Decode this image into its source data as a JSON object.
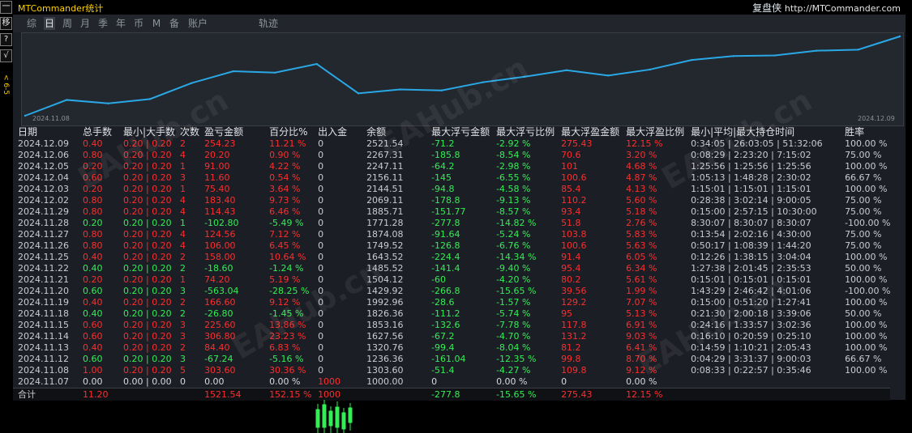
{
  "titlebar": {
    "app_name": "MTCommander统计",
    "brand": "复盘侠",
    "url": "http://MTCommander.com"
  },
  "left_tools": [
    "一",
    "移",
    "?",
    "√"
  ],
  "left_vertical_text": "< 6-5",
  "tabs": [
    "综",
    "日",
    "周",
    "月",
    "季",
    "年",
    "币",
    "M",
    "备",
    "账户",
    "轨迹"
  ],
  "active_tab": "日",
  "chart": {
    "start_date": "2024.11.08",
    "end_date": "2024.12.09",
    "line_color": "#2aa8e6"
  },
  "chart_data": {
    "type": "line",
    "x": [
      "2024.11.07",
      "2024.11.08",
      "2024.11.12",
      "2024.11.13",
      "2024.11.14",
      "2024.11.15",
      "2024.11.18",
      "2024.11.19",
      "2024.11.20",
      "2024.11.21",
      "2024.11.22",
      "2024.11.25",
      "2024.11.26",
      "2024.11.27",
      "2024.11.28",
      "2024.11.29",
      "2024.12.02",
      "2024.12.03",
      "2024.12.04",
      "2024.12.05",
      "2024.12.06",
      "2024.12.09"
    ],
    "series": [
      {
        "values": [
          1000,
          1303.6,
          1236.36,
          1320.76,
          1627.56,
          1853.16,
          1826.36,
          1992.96,
          1429.92,
          1504.12,
          1485.52,
          1643.52,
          1749.52,
          1874.08,
          1771.28,
          1885.71,
          2069.11,
          2144.51,
          2156.11,
          2247.11,
          2267.31,
          2521.54
        ]
      }
    ]
  },
  "table": {
    "headers": [
      "日期",
      "总手数",
      "最小|大手数",
      "次数",
      "盈亏金额",
      "百分比%",
      "出入金",
      "余额",
      "最大浮亏金额",
      "最大浮亏比例",
      "最大浮盈金额",
      "最大浮盈比例",
      "最小|平均|最大持仓时间",
      "胜率"
    ],
    "rows": [
      {
        "sign": "pos",
        "cells": [
          "2024.12.09",
          "0.40",
          "0.20 | 0.20",
          "2",
          "254.23",
          "11.21 %",
          "0",
          "2521.54",
          "-71.2",
          "-2.92 %",
          "275.43",
          "12.15 %",
          "0:34:05 | 26:03:05 | 51:32:06",
          "100.00 %"
        ]
      },
      {
        "sign": "pos",
        "cells": [
          "2024.12.06",
          "0.80",
          "0.20 | 0.20",
          "4",
          "20.20",
          "0.90 %",
          "0",
          "2267.31",
          "-185.8",
          "-8.54 %",
          "70.6",
          "3.20 %",
          "0:08:29 | 2:23:20 | 7:15:02",
          "75.00 %"
        ]
      },
      {
        "sign": "pos",
        "cells": [
          "2024.12.05",
          "0.20",
          "0.20 | 0.20",
          "1",
          "91.00",
          "4.22 %",
          "0",
          "2247.11",
          "-64.2",
          "-2.98 %",
          "101",
          "4.68 %",
          "1:25:56 | 1:25:56 | 1:25:56",
          "100.00 %"
        ]
      },
      {
        "sign": "pos",
        "cells": [
          "2024.12.04",
          "0.60",
          "0.20 | 0.20",
          "3",
          "11.60",
          "0.54 %",
          "0",
          "2156.11",
          "-145",
          "-6.55 %",
          "100.6",
          "4.87 %",
          "1:05:13 | 1:48:28 | 2:30:02",
          "66.67 %"
        ]
      },
      {
        "sign": "pos",
        "cells": [
          "2024.12.03",
          "0.20",
          "0.20 | 0.20",
          "1",
          "75.40",
          "3.64 %",
          "0",
          "2144.51",
          "-94.8",
          "-4.58 %",
          "85.4",
          "4.13 %",
          "1:15:01 | 1:15:01 | 1:15:01",
          "100.00 %"
        ]
      },
      {
        "sign": "pos",
        "cells": [
          "2024.12.02",
          "0.80",
          "0.20 | 0.20",
          "4",
          "183.40",
          "9.73 %",
          "0",
          "2069.11",
          "-178.8",
          "-9.13 %",
          "110.2",
          "5.60 %",
          "0:28:38 | 3:02:14 | 9:00:05",
          "75.00 %"
        ]
      },
      {
        "sign": "pos",
        "cells": [
          "2024.11.29",
          "0.80",
          "0.20 | 0.20",
          "4",
          "114.43",
          "6.46 %",
          "0",
          "1885.71",
          "-151.77",
          "-8.57 %",
          "93.4",
          "5.18 %",
          "0:15:00 | 2:57:15 | 10:30:00",
          "75.00 %"
        ]
      },
      {
        "sign": "neg",
        "cells": [
          "2024.11.28",
          "0.20",
          "0.20 | 0.20",
          "1",
          "-102.80",
          "-5.49 %",
          "0",
          "1771.28",
          "-277.8",
          "-14.82 %",
          "51.8",
          "2.76 %",
          "8:30:07 | 8:30:07 | 8:30:07",
          "-100.00 %"
        ]
      },
      {
        "sign": "pos",
        "cells": [
          "2024.11.27",
          "0.80",
          "0.20 | 0.20",
          "4",
          "124.56",
          "7.12 %",
          "0",
          "1874.08",
          "-91.64",
          "-5.24 %",
          "103.8",
          "5.83 %",
          "0:13:54 | 2:02:16 | 4:30:00",
          "75.00 %"
        ]
      },
      {
        "sign": "pos",
        "cells": [
          "2024.11.26",
          "0.80",
          "0.20 | 0.20",
          "4",
          "106.00",
          "6.45 %",
          "0",
          "1749.52",
          "-126.8",
          "-6.76 %",
          "100.6",
          "5.63 %",
          "0:50:17 | 1:08:39 | 1:44:20",
          "75.00 %"
        ]
      },
      {
        "sign": "pos",
        "cells": [
          "2024.11.25",
          "0.40",
          "0.20 | 0.20",
          "2",
          "158.00",
          "10.64 %",
          "0",
          "1643.52",
          "-224.4",
          "-14.34 %",
          "91.4",
          "6.05 %",
          "0:12:26 | 1:38:15 | 3:04:04",
          "100.00 %"
        ]
      },
      {
        "sign": "neg",
        "cells": [
          "2024.11.22",
          "0.40",
          "0.20 | 0.20",
          "2",
          "-18.60",
          "-1.24 %",
          "0",
          "1485.52",
          "-141.4",
          "-9.40 %",
          "95.4",
          "6.34 %",
          "1:27:38 | 2:01:45 | 2:35:53",
          "50.00 %"
        ]
      },
      {
        "sign": "pos",
        "cells": [
          "2024.11.21",
          "0.20",
          "0.20 | 0.20",
          "1",
          "74.20",
          "5.19 %",
          "0",
          "1504.12",
          "-60",
          "-4.20 %",
          "80.2",
          "5.61 %",
          "0:15:01 | 0:15:01 | 0:15:01",
          "100.00 %"
        ]
      },
      {
        "sign": "neg",
        "cells": [
          "2024.11.20",
          "0.60",
          "0.20 | 0.20",
          "3",
          "-563.04",
          "-28.25 %",
          "0",
          "1429.92",
          "-266.8",
          "-15.65 %",
          "39.56",
          "1.99 %",
          "1:43:29 | 2:46:42 | 4:01:06",
          "-100.00 %"
        ]
      },
      {
        "sign": "pos",
        "cells": [
          "2024.11.19",
          "0.40",
          "0.20 | 0.20",
          "2",
          "166.60",
          "9.12 %",
          "0",
          "1992.96",
          "-28.6",
          "-1.57 %",
          "129.2",
          "7.07 %",
          "0:15:00 | 0:51:20 | 1:27:41",
          "100.00 %"
        ]
      },
      {
        "sign": "neg",
        "cells": [
          "2024.11.18",
          "0.40",
          "0.20 | 0.20",
          "2",
          "-26.80",
          "-1.45 %",
          "0",
          "1826.36",
          "-111.2",
          "-5.74 %",
          "95",
          "5.13 %",
          "0:21:30 | 2:00:18 | 3:39:06",
          "50.00 %"
        ]
      },
      {
        "sign": "pos",
        "cells": [
          "2024.11.15",
          "0.60",
          "0.20 | 0.20",
          "3",
          "225.60",
          "13.86 %",
          "0",
          "1853.16",
          "-132.6",
          "-7.78 %",
          "117.8",
          "6.91 %",
          "0:24:16 | 1:33:57 | 3:02:36",
          "100.00 %"
        ]
      },
      {
        "sign": "pos",
        "cells": [
          "2024.11.14",
          "0.60",
          "0.20 | 0.20",
          "3",
          "306.80",
          "23.23 %",
          "0",
          "1627.56",
          "-67.2",
          "-4.70 %",
          "131.2",
          "9.03 %",
          "0:16:10 | 0:20:59 | 0:25:10",
          "100.00 %"
        ]
      },
      {
        "sign": "pos",
        "cells": [
          "2024.11.13",
          "0.40",
          "0.20 | 0.20",
          "2",
          "84.40",
          "6.83 %",
          "0",
          "1320.76",
          "-99.4",
          "-8.04 %",
          "81.2",
          "6.41 %",
          "0:14:59 | 1:10:21 | 2:05:43",
          "100.00 %"
        ]
      },
      {
        "sign": "neg",
        "cells": [
          "2024.11.12",
          "0.60",
          "0.20 | 0.20",
          "3",
          "-67.24",
          "-5.16 %",
          "0",
          "1236.36",
          "-161.04",
          "-12.35 %",
          "99.8",
          "8.70 %",
          "0:04:29 | 3:31:37 | 9:00:03",
          "66.67 %"
        ]
      },
      {
        "sign": "pos",
        "cells": [
          "2024.11.08",
          "1.00",
          "0.20 | 0.20",
          "5",
          "303.60",
          "30.36 %",
          "0",
          "1303.60",
          "-51.4",
          "-4.27 %",
          "109.8",
          "9.12 %",
          "0:08:33 | 0:22:57 | 0:35:46",
          "100.00 %"
        ]
      },
      {
        "sign": "zero",
        "cells": [
          "2024.11.07",
          "0.00",
          "0.00 | 0.00",
          "0",
          "0.00",
          "0.00 %",
          "1000",
          "1000.00",
          "0",
          "0.00 %",
          "0",
          "0.00 %",
          "",
          ""
        ]
      }
    ],
    "summary": [
      "合计",
      "11.20",
      "",
      "",
      "1521.54",
      "152.15 %",
      "1000",
      "",
      "-277.8",
      "-15.65 %",
      "275.43",
      "12.15 %",
      "",
      ""
    ]
  },
  "watermark": "EAHub.cn",
  "colors": {
    "profit": "#ff2d2d",
    "loss": "#33ee55",
    "accent": "#ffd200",
    "line": "#2aa8e6"
  }
}
